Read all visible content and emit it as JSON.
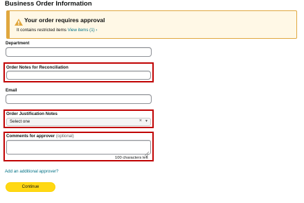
{
  "page": {
    "section_title": "Business Order Information"
  },
  "alert": {
    "title": "Your order requires approval",
    "body": "It contains restricted items",
    "link": "View items (1) ›",
    "icon": "warning-icon",
    "accent_color": "#e0a73e"
  },
  "form": {
    "department": {
      "label": "Department",
      "value": ""
    },
    "order_notes": {
      "label": "Order Notes for Reconciliation",
      "value": ""
    },
    "email": {
      "label": "Email",
      "value": ""
    },
    "justification": {
      "label": "Order Justification Notes",
      "selected": "Select one",
      "clear_glyph": "×",
      "chevron_glyph": "▼"
    },
    "comments": {
      "label": "Comments for approver",
      "optional": "(optional)",
      "value": "",
      "char_count": "100 characters left"
    },
    "add_approver": "Add an additional approver?",
    "continue_label": "Continue"
  },
  "colors": {
    "highlight": "#c00000",
    "link": "#007185",
    "button": "#ffd814"
  }
}
